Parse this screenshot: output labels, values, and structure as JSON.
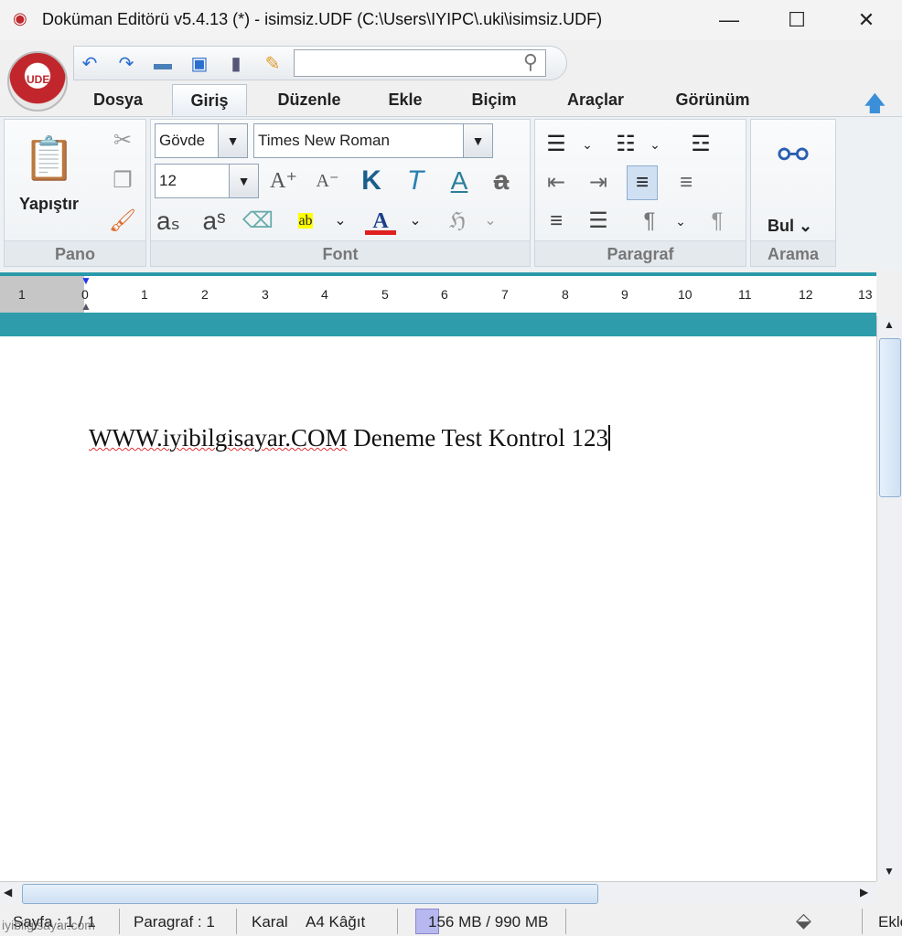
{
  "window": {
    "title": "Doküman Editörü v5.4.13 (*) - isimsiz.UDF (C:\\Users\\IYIPC\\.uki\\isimsiz.UDF)",
    "minimize": "—",
    "maximize": "☐",
    "close": "✕"
  },
  "logo": {
    "text": "UDE"
  },
  "quick_access": {
    "search_value": "",
    "icons": [
      "undo-icon",
      "redo-icon",
      "open-folder-icon",
      "save-icon",
      "print-icon",
      "edit-icon",
      "search-icon"
    ]
  },
  "tabs": [
    {
      "label": "Dosya"
    },
    {
      "label": "Giriş",
      "active": true
    },
    {
      "label": "Düzenle"
    },
    {
      "label": "Ekle"
    },
    {
      "label": "Biçim"
    },
    {
      "label": "Araçlar"
    },
    {
      "label": "Görünüm"
    }
  ],
  "ribbon": {
    "pano": {
      "label": "Pano",
      "paste": "Yapıştır"
    },
    "font": {
      "label": "Font",
      "style": "Gövde",
      "family": "Times New Roman",
      "size": "12",
      "bold": "K",
      "italic": "T",
      "underline": "A",
      "strike": "a",
      "grow": "A⁺",
      "shrink": "A⁻",
      "subscript": "aₛ",
      "superscript": "aˢ",
      "highlight": "ab",
      "color": "A"
    },
    "paragraf": {
      "label": "Paragraf"
    },
    "arama": {
      "label": "Arama",
      "find": "Bul"
    }
  },
  "ruler": {
    "numbers": [
      "1",
      "0",
      "1",
      "2",
      "3",
      "4",
      "5",
      "6",
      "7",
      "8",
      "9",
      "10",
      "11",
      "12",
      "13"
    ]
  },
  "document": {
    "text_plain": "WWW.iyibilgisayar.COM",
    "text_rest": " Deneme Test Kontrol 123"
  },
  "status": {
    "page": "Sayfa : 1 / 1",
    "paragraph": "Paragraf : 1",
    "font_style": "Karal",
    "paper": "A4 Kâğıt",
    "memory": "156 MB / 990 MB",
    "mode": "Ekle",
    "watermark": "iyibilgisayar.com"
  },
  "colors": {
    "accent": "#2e9cab",
    "font_color": "#e02020",
    "highlight": "#ffff00"
  }
}
